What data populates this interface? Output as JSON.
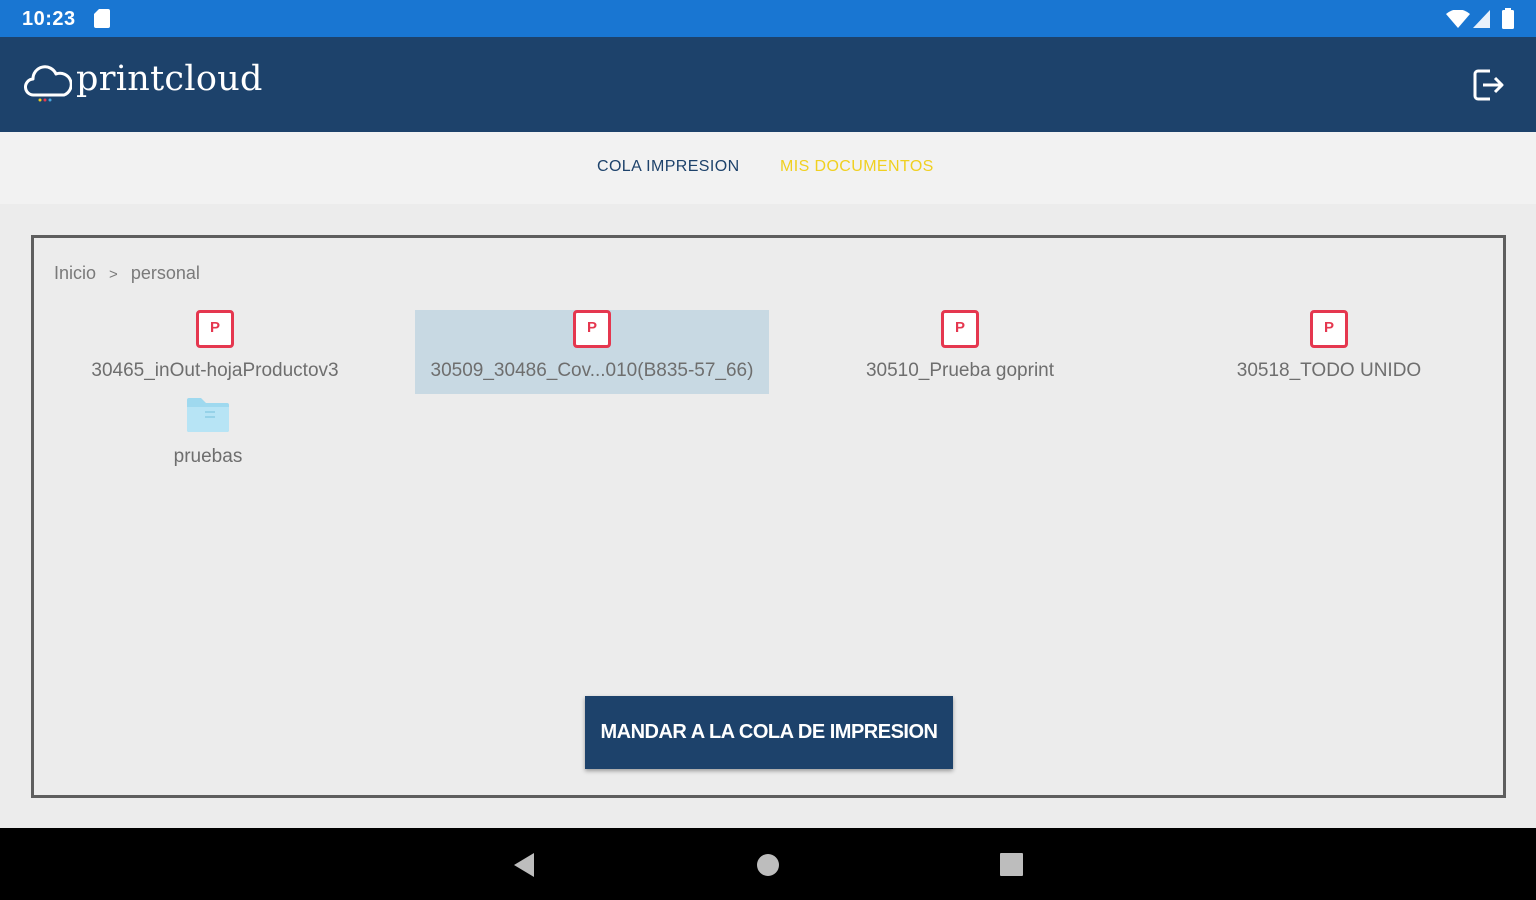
{
  "status_bar": {
    "time": "10:23",
    "icons": [
      "sd-card-icon",
      "wifi-icon",
      "signal-icon",
      "battery-icon"
    ]
  },
  "app_bar": {
    "title": "printcloud",
    "logo_icon": "cloud-icon",
    "logout_icon": "logout-icon"
  },
  "tabs": [
    {
      "label": "COLA IMPRESION",
      "active": false
    },
    {
      "label": "MIS DOCUMENTOS",
      "active": true
    }
  ],
  "breadcrumb": {
    "items": [
      "Inicio",
      "personal"
    ],
    "separator": ">"
  },
  "files": [
    {
      "name": "30465_inOut-hojaProductov3",
      "type": "pdf",
      "icon_letter": "P",
      "selected": false
    },
    {
      "name": "30509_30486_Cov...010(B835-57_66)",
      "type": "pdf",
      "icon_letter": "P",
      "selected": true
    },
    {
      "name": "30510_Prueba goprint",
      "type": "pdf",
      "icon_letter": "P",
      "selected": false
    },
    {
      "name": "30518_TODO UNIDO",
      "type": "pdf",
      "icon_letter": "P",
      "selected": false
    },
    {
      "name": "pruebas",
      "type": "folder",
      "selected": false
    }
  ],
  "actions": {
    "send_label": "MANDAR A LA COLA DE IMPRESION"
  },
  "colors": {
    "status_bar": "#1976d2",
    "app_bar": "#1d426b",
    "active_tab": "#f0d020",
    "pdf_icon": "#e5374f",
    "folder_icon": "#9fd9ef",
    "selected_bg": "#c8d9e3"
  },
  "nav_bar": {
    "icons": [
      "back-icon",
      "home-icon",
      "recents-icon"
    ]
  }
}
